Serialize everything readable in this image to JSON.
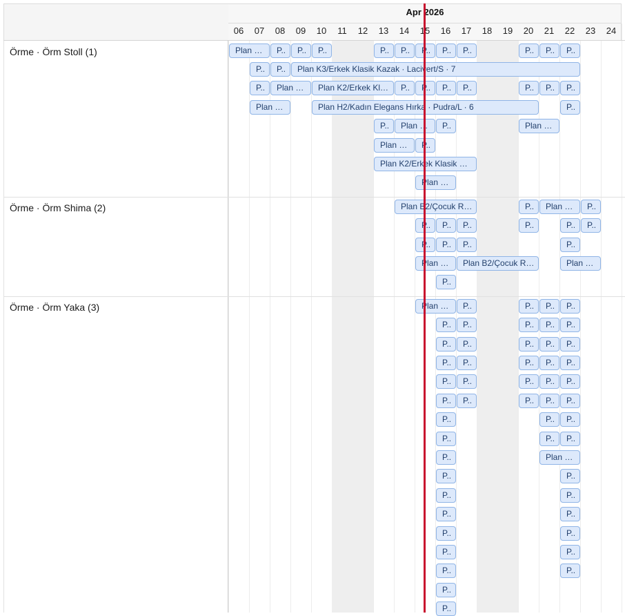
{
  "timeline": {
    "month_label": "Apr 2026",
    "days": [
      "06",
      "07",
      "08",
      "09",
      "10",
      "11",
      "12",
      "13",
      "14",
      "15",
      "16",
      "17",
      "18",
      "19",
      "20",
      "21",
      "22",
      "23",
      "24"
    ],
    "weekend_days": [
      "11",
      "12",
      "18",
      "19"
    ],
    "today": "15"
  },
  "groups": [
    {
      "label": "Örme · Örm Stoll (1)",
      "rows": [
        [
          {
            "day": "06",
            "span": 2,
            "label": "Plan …"
          },
          {
            "day": "08",
            "span": 1,
            "label": "P.."
          },
          {
            "day": "09",
            "span": 1,
            "label": "P.."
          },
          {
            "day": "10",
            "span": 1,
            "label": "P.."
          },
          {
            "day": "13",
            "span": 1,
            "label": "P.."
          },
          {
            "day": "14",
            "span": 1,
            "label": "P.."
          },
          {
            "day": "15",
            "span": 1,
            "label": "P.."
          },
          {
            "day": "16",
            "span": 1,
            "label": "P.."
          },
          {
            "day": "17",
            "span": 1,
            "label": "P.."
          },
          {
            "day": "20",
            "span": 1,
            "label": "P.."
          },
          {
            "day": "21",
            "span": 1,
            "label": "P.."
          },
          {
            "day": "22",
            "span": 1,
            "label": "P.."
          }
        ],
        [
          {
            "day": "07",
            "span": 1,
            "label": "P.."
          },
          {
            "day": "08",
            "span": 1,
            "label": "P.."
          },
          {
            "day": "09",
            "span": 14,
            "label": "Plan K3/Erkek Klasik Kazak · Lacivert/S · 7"
          }
        ],
        [
          {
            "day": "07",
            "span": 1,
            "label": "P.."
          },
          {
            "day": "08",
            "span": 2,
            "label": "Plan …"
          },
          {
            "day": "10",
            "span": 4,
            "label": "Plan K2/Erkek Kl…"
          },
          {
            "day": "14",
            "span": 1,
            "label": "P.."
          },
          {
            "day": "15",
            "span": 1,
            "label": "P.."
          },
          {
            "day": "16",
            "span": 1,
            "label": "P.."
          },
          {
            "day": "17",
            "span": 1,
            "label": "P.."
          },
          {
            "day": "20",
            "span": 1,
            "label": "P.."
          },
          {
            "day": "21",
            "span": 1,
            "label": "P.."
          },
          {
            "day": "22",
            "span": 1,
            "label": "P.."
          }
        ],
        [
          {
            "day": "07",
            "span": 2,
            "label": "Plan …"
          },
          {
            "day": "10",
            "span": 11,
            "label": "Plan H2/Kadın Elegans Hırka · Pudra/L · 6"
          },
          {
            "day": "22",
            "span": 1,
            "label": "P.."
          }
        ],
        [
          {
            "day": "13",
            "span": 1,
            "label": "P.."
          },
          {
            "day": "14",
            "span": 2,
            "label": "Plan …"
          },
          {
            "day": "16",
            "span": 1,
            "label": "P.."
          },
          {
            "day": "20",
            "span": 2,
            "label": "Plan …"
          }
        ],
        [
          {
            "day": "13",
            "span": 2,
            "label": "Plan …"
          },
          {
            "day": "15",
            "span": 1,
            "label": "P.."
          }
        ],
        [
          {
            "day": "13",
            "span": 5,
            "label": "Plan K2/Erkek Klasik …"
          }
        ],
        [
          {
            "day": "15",
            "span": 2,
            "label": "Plan …"
          }
        ]
      ]
    },
    {
      "label": "Örme · Örm Shima (2)",
      "rows": [
        [
          {
            "day": "14",
            "span": 4,
            "label": "Plan B2/Çocuk R…"
          },
          {
            "day": "20",
            "span": 1,
            "label": "P.."
          },
          {
            "day": "21",
            "span": 2,
            "label": "Plan …"
          },
          {
            "day": "23",
            "span": 1,
            "label": "P.."
          }
        ],
        [
          {
            "day": "15",
            "span": 1,
            "label": "P.."
          },
          {
            "day": "16",
            "span": 1,
            "label": "P.."
          },
          {
            "day": "17",
            "span": 1,
            "label": "P.."
          },
          {
            "day": "20",
            "span": 1,
            "label": "P.."
          },
          {
            "day": "22",
            "span": 1,
            "label": "P.."
          },
          {
            "day": "23",
            "span": 1,
            "label": "P.."
          }
        ],
        [
          {
            "day": "15",
            "span": 1,
            "label": "P.."
          },
          {
            "day": "16",
            "span": 1,
            "label": "P.."
          },
          {
            "day": "17",
            "span": 1,
            "label": "P.."
          },
          {
            "day": "22",
            "span": 1,
            "label": "P.."
          }
        ],
        [
          {
            "day": "15",
            "span": 2,
            "label": "Plan …"
          },
          {
            "day": "17",
            "span": 4,
            "label": "Plan B2/Çocuk R…"
          },
          {
            "day": "22",
            "span": 2,
            "label": "Plan …"
          }
        ],
        [
          {
            "day": "16",
            "span": 1,
            "label": "P.."
          }
        ]
      ]
    },
    {
      "label": "Örme · Örm Yaka (3)",
      "rows": [
        [
          {
            "day": "15",
            "span": 2,
            "label": "Plan …"
          },
          {
            "day": "17",
            "span": 1,
            "label": "P.."
          },
          {
            "day": "20",
            "span": 1,
            "label": "P.."
          },
          {
            "day": "21",
            "span": 1,
            "label": "P.."
          },
          {
            "day": "22",
            "span": 1,
            "label": "P.."
          }
        ],
        [
          {
            "day": "16",
            "span": 1,
            "label": "P.."
          },
          {
            "day": "17",
            "span": 1,
            "label": "P.."
          },
          {
            "day": "20",
            "span": 1,
            "label": "P.."
          },
          {
            "day": "21",
            "span": 1,
            "label": "P.."
          },
          {
            "day": "22",
            "span": 1,
            "label": "P.."
          }
        ],
        [
          {
            "day": "16",
            "span": 1,
            "label": "P.."
          },
          {
            "day": "17",
            "span": 1,
            "label": "P.."
          },
          {
            "day": "20",
            "span": 1,
            "label": "P.."
          },
          {
            "day": "21",
            "span": 1,
            "label": "P.."
          },
          {
            "day": "22",
            "span": 1,
            "label": "P.."
          }
        ],
        [
          {
            "day": "16",
            "span": 1,
            "label": "P.."
          },
          {
            "day": "17",
            "span": 1,
            "label": "P.."
          },
          {
            "day": "20",
            "span": 1,
            "label": "P.."
          },
          {
            "day": "21",
            "span": 1,
            "label": "P.."
          },
          {
            "day": "22",
            "span": 1,
            "label": "P.."
          }
        ],
        [
          {
            "day": "16",
            "span": 1,
            "label": "P.."
          },
          {
            "day": "17",
            "span": 1,
            "label": "P.."
          },
          {
            "day": "20",
            "span": 1,
            "label": "P.."
          },
          {
            "day": "21",
            "span": 1,
            "label": "P.."
          },
          {
            "day": "22",
            "span": 1,
            "label": "P.."
          }
        ],
        [
          {
            "day": "16",
            "span": 1,
            "label": "P.."
          },
          {
            "day": "17",
            "span": 1,
            "label": "P.."
          },
          {
            "day": "20",
            "span": 1,
            "label": "P.."
          },
          {
            "day": "21",
            "span": 1,
            "label": "P.."
          },
          {
            "day": "22",
            "span": 1,
            "label": "P.."
          }
        ],
        [
          {
            "day": "16",
            "span": 1,
            "label": "P.."
          },
          {
            "day": "21",
            "span": 1,
            "label": "P.."
          },
          {
            "day": "22",
            "span": 1,
            "label": "P.."
          }
        ],
        [
          {
            "day": "16",
            "span": 1,
            "label": "P.."
          },
          {
            "day": "21",
            "span": 1,
            "label": "P.."
          },
          {
            "day": "22",
            "span": 1,
            "label": "P.."
          }
        ],
        [
          {
            "day": "16",
            "span": 1,
            "label": "P.."
          },
          {
            "day": "21",
            "span": 2,
            "label": "Plan …"
          }
        ],
        [
          {
            "day": "16",
            "span": 1,
            "label": "P.."
          },
          {
            "day": "22",
            "span": 1,
            "label": "P.."
          }
        ],
        [
          {
            "day": "16",
            "span": 1,
            "label": "P.."
          },
          {
            "day": "22",
            "span": 1,
            "label": "P.."
          }
        ],
        [
          {
            "day": "16",
            "span": 1,
            "label": "P.."
          },
          {
            "day": "22",
            "span": 1,
            "label": "P.."
          }
        ],
        [
          {
            "day": "16",
            "span": 1,
            "label": "P.."
          },
          {
            "day": "22",
            "span": 1,
            "label": "P.."
          }
        ],
        [
          {
            "day": "16",
            "span": 1,
            "label": "P.."
          },
          {
            "day": "22",
            "span": 1,
            "label": "P.."
          }
        ],
        [
          {
            "day": "16",
            "span": 1,
            "label": "P.."
          },
          {
            "day": "22",
            "span": 1,
            "label": "P.."
          }
        ],
        [
          {
            "day": "16",
            "span": 1,
            "label": "P.."
          }
        ],
        [
          {
            "day": "16",
            "span": 1,
            "label": "P.."
          }
        ]
      ]
    }
  ],
  "colors": {
    "task_fill": "#dde9fb",
    "task_border": "#8fb4e6",
    "today_line": "#c8102e",
    "weekend": "#eeeeee"
  }
}
